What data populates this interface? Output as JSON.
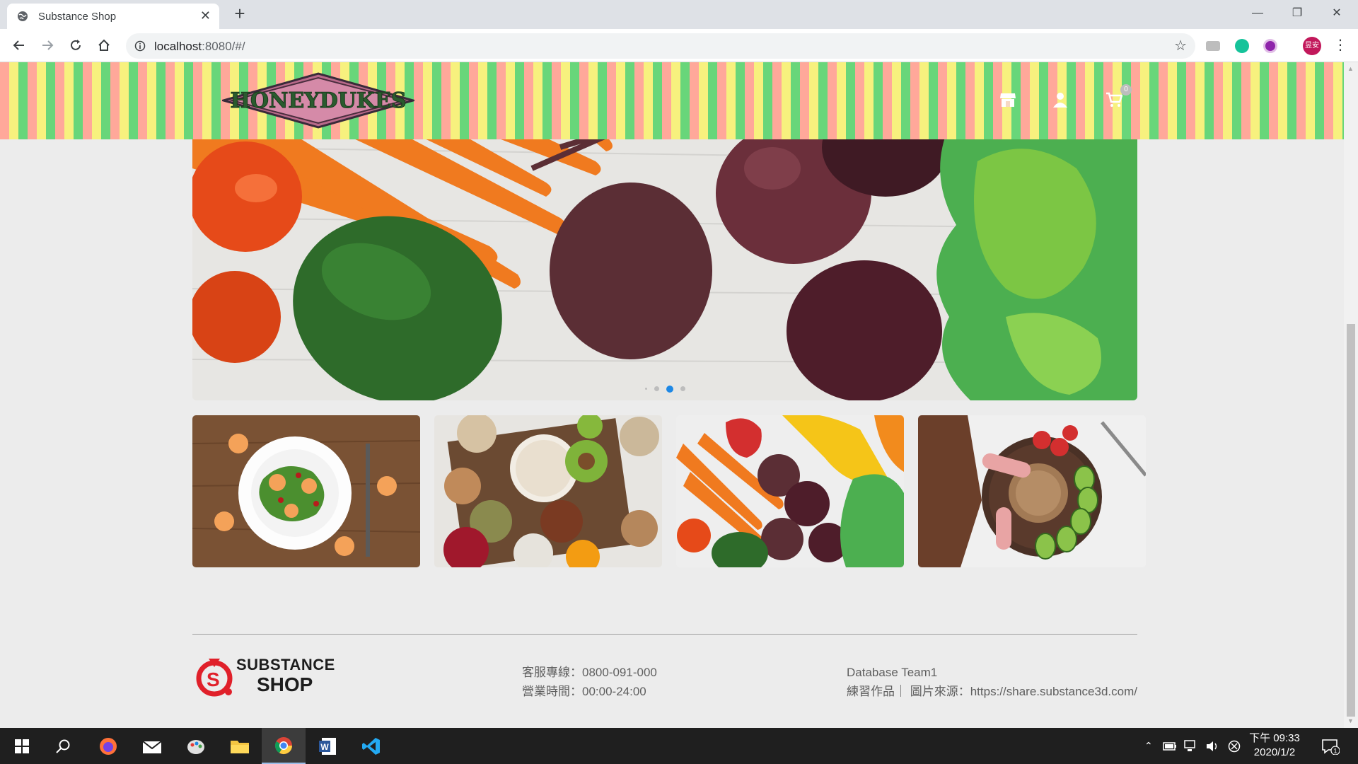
{
  "browser": {
    "tab_title": "Substance Shop",
    "tab_close": "✕",
    "new_tab": "+",
    "url_host": "localhost",
    "url_path": ":8080/#/",
    "window_controls": {
      "minimize": "—",
      "maximize": "❐",
      "close": "✕"
    },
    "profile_label": "昱安"
  },
  "header": {
    "logo_text": "HONEYDUKES",
    "icons": [
      "store-icon",
      "user-icon",
      "cart-icon"
    ],
    "cart_count": "0"
  },
  "hero": {
    "slides": 4,
    "active_slide": 3
  },
  "cards": [
    {
      "name": "salad-plate-card"
    },
    {
      "name": "nuts-beans-card"
    },
    {
      "name": "vegetables-card"
    },
    {
      "name": "buckwheat-plate-card"
    }
  ],
  "footer": {
    "brand_line1": "SUBSTANCE",
    "brand_line2": "SHOP",
    "service_phone": "客服專線：0800-091-000",
    "business_hours": "營業時間：00:00-24:00",
    "team": "Database Team1",
    "credits": "練習作品｜ 圖片來源：https://share.substance3d.com/"
  },
  "taskbar": {
    "clock_time": "下午 09:33",
    "clock_date": "2020/1/2",
    "notification_count": "1"
  },
  "colors": {
    "stripe_pink": "#ffa89a",
    "stripe_yellow": "#f7f17e",
    "stripe_green": "#68d67a",
    "carousel_active": "#1e88e5",
    "brand_red": "#e0202a"
  }
}
